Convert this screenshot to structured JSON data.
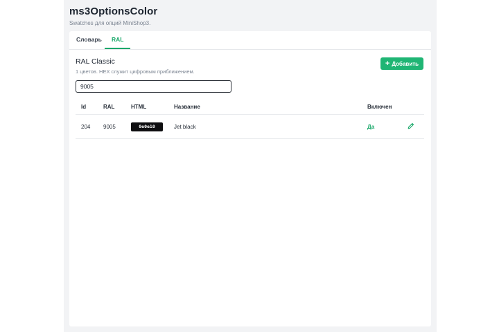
{
  "app": {
    "title": "ms3OptionsColor",
    "subtitle": "Swatches для опций MiniShop3."
  },
  "tabs": [
    {
      "label": "Словарь",
      "active": false
    },
    {
      "label": "RAL",
      "active": true
    }
  ],
  "section": {
    "title": "RAL Classic",
    "subtitle": "1 цветов. HEX служит цифровым приближением.",
    "add_label": "Добавить"
  },
  "search": {
    "value": "9005"
  },
  "table": {
    "headers": {
      "id": "Id",
      "ral": "RAL",
      "html": "HTML",
      "name": "Название",
      "enabled": "Включен"
    },
    "rows": [
      {
        "id": "204",
        "ral": "9005",
        "html": "0e0e10",
        "swatch_color": "#0e0e10",
        "name": "Jet black",
        "enabled": "Да"
      }
    ]
  },
  "colors": {
    "accent": "#1fb574",
    "accent_text": "#1aa86a"
  },
  "icons": {
    "add": "plus-icon",
    "edit": "pencil-icon"
  }
}
